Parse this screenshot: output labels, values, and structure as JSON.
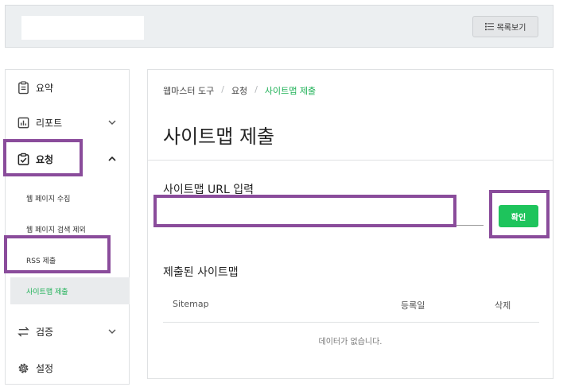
{
  "header": {
    "list_button_label": "목록보기",
    "list_icon": "list-icon"
  },
  "sidebar": {
    "items": [
      {
        "label": "요약",
        "icon": "document-icon"
      },
      {
        "label": "리포트",
        "icon": "chart-icon",
        "chevron": "chevron-down-icon"
      },
      {
        "label": "요청",
        "icon": "checkbox-icon",
        "chevron": "chevron-up-icon"
      },
      {
        "label": "검증",
        "icon": "swap-icon",
        "chevron": "chevron-down-icon"
      },
      {
        "label": "설정",
        "icon": "gear-icon"
      }
    ],
    "sub_items": [
      {
        "label": "웹 페이지 수집"
      },
      {
        "label": "웹 페이지 검색 제외"
      },
      {
        "label": "RSS 제출"
      },
      {
        "label": "사이트맵 제출"
      }
    ]
  },
  "main": {
    "breadcrumb": [
      "웹마스터 도구",
      "요청",
      "사이트맵 제출"
    ],
    "breadcrumb_sep": "/",
    "title": "사이트맵 제출",
    "url_label": "사이트맵 URL 입력",
    "url_value": "",
    "confirm_label": "확인",
    "submitted_title": "제출된 사이트맵",
    "table": {
      "columns": [
        "Sitemap",
        "등록일",
        "삭제"
      ],
      "empty_text": "데이터가 없습니다."
    }
  },
  "colors": {
    "accent_green": "#1ec45c",
    "highlight_purple": "#8a4c9b"
  }
}
